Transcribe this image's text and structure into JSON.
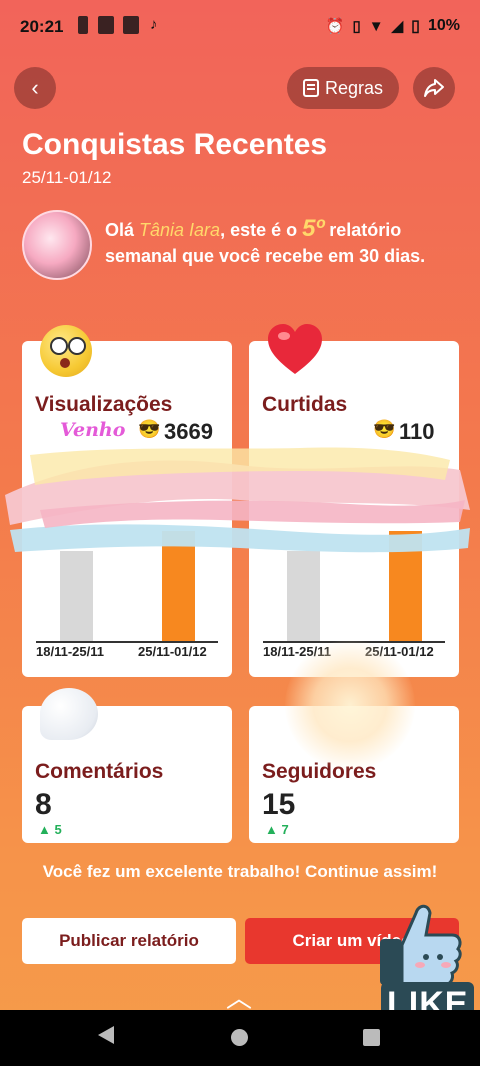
{
  "status_bar": {
    "time": "20:21",
    "battery": "10%"
  },
  "header": {
    "rules_label": "Regras",
    "title": "Conquistas Recentes",
    "dates": "25/11-01/12"
  },
  "greeting": {
    "prefix": "Olá ",
    "name": "Tânia Iara",
    "middle": ", este é o ",
    "number": "5º",
    "suffix": " relatório semanal que você recebe em 30 dias."
  },
  "views": {
    "label": "Visualizações",
    "value": "3669",
    "sticker": "Venho",
    "x_labels": [
      "18/11-25/11",
      "25/11-01/12"
    ]
  },
  "likes": {
    "label": "Curtidas",
    "value": "110",
    "x_labels": [
      "18/11-25/11",
      "25/11-01/12"
    ]
  },
  "comments": {
    "label": "Comentários",
    "value": "8",
    "delta": "5"
  },
  "followers": {
    "label": "Seguidores",
    "value": "15",
    "delta": "7"
  },
  "congrats": "Você fez um excelente trabalho! Continue assim!",
  "buttons": {
    "publish": "Publicar relatório",
    "create": "Criar um vídeo"
  },
  "like_badge": "LIKE",
  "colors": {
    "accent": "#e8372e",
    "brand_dark": "#7b1d1d",
    "bar_current": "#f7881f",
    "bar_previous": "#d8d8d8"
  }
}
